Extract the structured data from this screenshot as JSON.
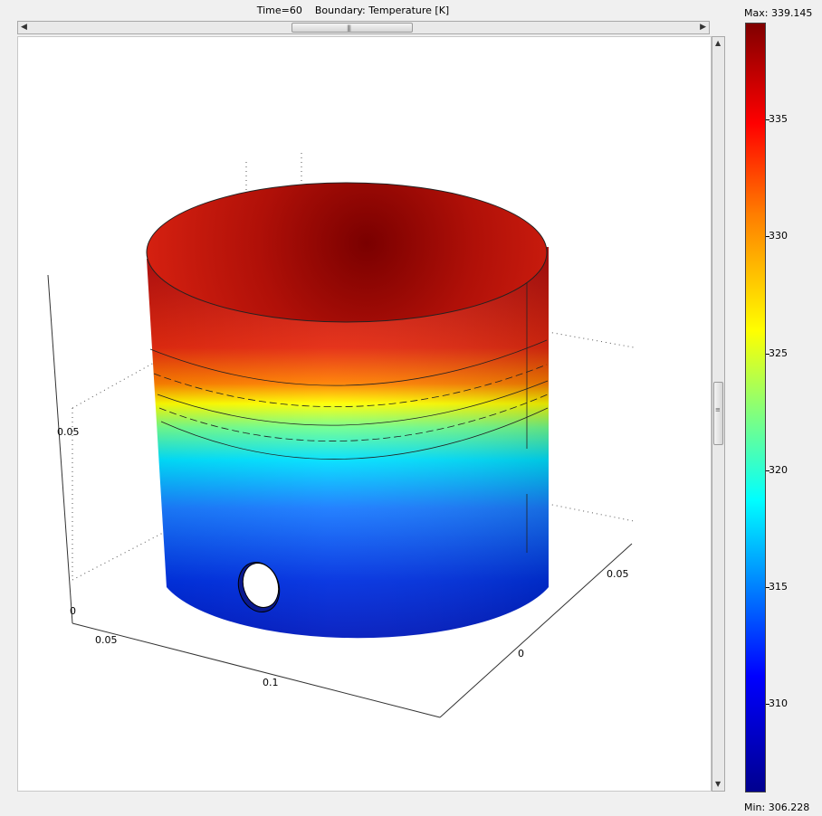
{
  "title": "Time=60    Boundary: Temperature [K]",
  "colorbar": {
    "max_label": "Max: 339.145",
    "min_label": "Min: 306.228",
    "min": 306.228,
    "max": 339.145,
    "ticks": [
      "335",
      "330",
      "325",
      "320",
      "315",
      "310"
    ],
    "tick_values": [
      335,
      330,
      325,
      320,
      315,
      310
    ]
  },
  "axes": {
    "z_tick_1": "0.05",
    "z_tick_0": "0",
    "x_tick_1": "0.05",
    "x_tick_2": "0.1",
    "y_tick_0": "0",
    "y_tick_1": "0.05"
  },
  "colors": {
    "hot": "#8b0000",
    "cold": "#00008f",
    "plot_background": "#ffffff",
    "window_background": "#f0f0f0"
  },
  "scrollbars": {
    "left_arrow": "◀",
    "right_arrow": "▶",
    "up_arrow": "▲",
    "down_arrow": "▼"
  }
}
